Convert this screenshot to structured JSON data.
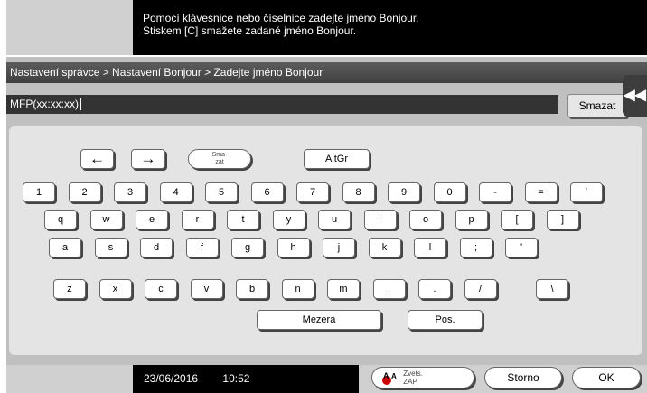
{
  "message": {
    "line1": "Pomocí klávesnice nebo číselnice zadejte jméno Bonjour.",
    "line2": "Stiskem [C] smažete zadané jméno Bonjour."
  },
  "breadcrumb": "Nastavení správce > Nastavení Bonjour > Zadejte jméno Bonjour",
  "input": {
    "value": "MFP(xx:xx:xx)"
  },
  "clear_button": "Smazat",
  "side_tab_glyph": "◀◀",
  "controls": {
    "left_arrow": "←",
    "right_arrow": "→",
    "delete_line1": "Sma-",
    "delete_line2": "zat",
    "altgr": "AltGr"
  },
  "rows": [
    [
      "1",
      "2",
      "3",
      "4",
      "5",
      "6",
      "7",
      "8",
      "9",
      "0",
      "-",
      "=",
      "`"
    ],
    [
      "q",
      "w",
      "e",
      "r",
      "t",
      "y",
      "u",
      "i",
      "o",
      "p",
      "[",
      "]"
    ],
    [
      "a",
      "s",
      "d",
      "f",
      "g",
      "h",
      "j",
      "k",
      "l",
      ";",
      "'"
    ],
    [
      "z",
      "x",
      "c",
      "v",
      "b",
      "n",
      "m",
      ",",
      ".",
      "/",
      "\\"
    ]
  ],
  "space_label": "Mezera",
  "pos_label": "Pos.",
  "status": {
    "date": "23/06/2016",
    "time": "10:52",
    "expand_line1": "Zvets.",
    "expand_line2": "ZAP",
    "storno": "Storno",
    "ok": "OK"
  }
}
